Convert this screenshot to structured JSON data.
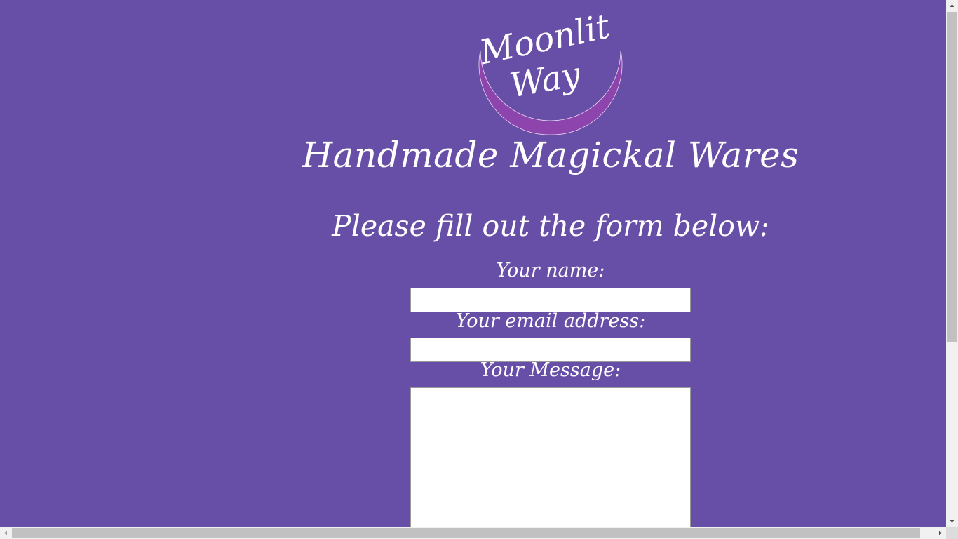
{
  "brand": {
    "logo_line1": "Moonlit",
    "logo_line2": "Way",
    "tagline": "Handmade Magickal Wares"
  },
  "form": {
    "heading": "Please fill out the form below:",
    "name_label": "Your name:",
    "name_value": "",
    "email_label": "Your email address:",
    "email_value": "",
    "message_label": "Your Message:",
    "message_value": ""
  },
  "colors": {
    "background": "#674ea7",
    "crescent": "#8e44ad",
    "text": "#ffffff"
  },
  "icons": {
    "scroll_up": "triangle-up-icon",
    "scroll_down": "triangle-down-icon",
    "scroll_left": "triangle-left-icon",
    "scroll_right": "triangle-right-icon"
  }
}
